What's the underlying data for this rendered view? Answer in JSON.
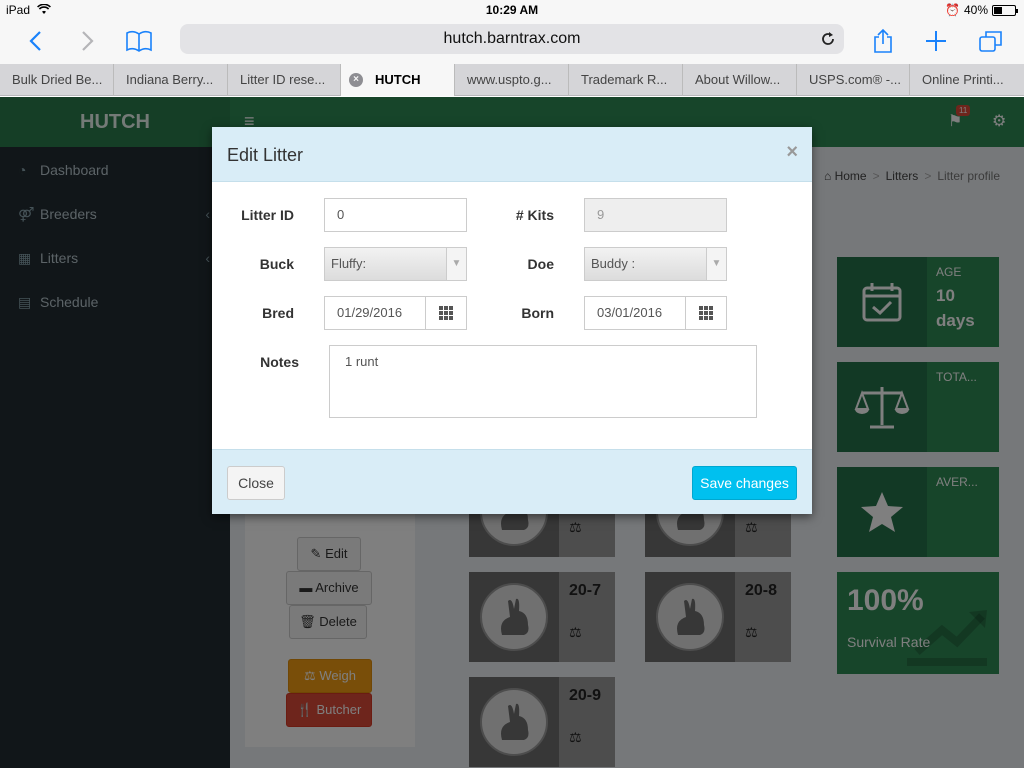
{
  "status": {
    "device": "iPad",
    "time": "10:29 AM",
    "battery": "40%"
  },
  "browser": {
    "url": "hutch.barntrax.com",
    "tabs": [
      {
        "label": "Bulk Dried Be..."
      },
      {
        "label": "Indiana Berry..."
      },
      {
        "label": "Litter ID rese..."
      },
      {
        "label": "HUTCH"
      },
      {
        "label": "www.uspto.g..."
      },
      {
        "label": "Trademark R..."
      },
      {
        "label": "About Willow..."
      },
      {
        "label": "USPS.com® -..."
      },
      {
        "label": "Online Printi..."
      }
    ]
  },
  "app": {
    "logo": "HUTCH",
    "notif_count": "11",
    "sidebar": [
      {
        "label": "Dashboard"
      },
      {
        "label": "Breeders"
      },
      {
        "label": "Litters"
      },
      {
        "label": "Schedule"
      }
    ],
    "breadcrumb": {
      "home": "Home",
      "litters": "Litters",
      "current": "Litter profile"
    },
    "profile_buttons": {
      "edit": "Edit",
      "archive": "Archive",
      "delete": "Delete",
      "weigh": "Weigh",
      "butcher": "Butcher"
    },
    "kits": [
      {
        "name": ""
      },
      {
        "name": ""
      },
      {
        "name": "20-7"
      },
      {
        "name": "20-8"
      },
      {
        "name": "20-9"
      }
    ],
    "stats": {
      "age_label": "AGE",
      "age_value": "10 days",
      "total_label": "TOTA...",
      "avg_label": "AVER...",
      "survival_value": "100%",
      "survival_label": "Survival Rate"
    }
  },
  "modal": {
    "title": "Edit Litter",
    "close_x": "×",
    "litter_id_label": "Litter ID",
    "litter_id_value": "0",
    "kits_label": "# Kits",
    "kits_value": "9",
    "buck_label": "Buck",
    "buck_value": "Fluffy:",
    "doe_label": "Doe",
    "doe_value": "Buddy :",
    "bred_label": "Bred",
    "bred_value": "01/29/2016",
    "born_label": "Born",
    "born_value": "03/01/2016",
    "notes_label": "Notes",
    "notes_value": "1 runt",
    "close_button": "Close",
    "save_button": "Save changes"
  }
}
